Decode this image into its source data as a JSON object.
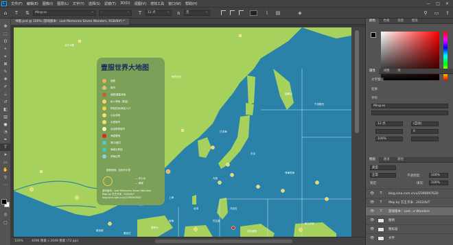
{
  "app": {
    "logo": "Ps"
  },
  "menu": [
    "文件(F)",
    "编辑(E)",
    "图像(I)",
    "图层(L)",
    "文字(Y)",
    "选择(S)",
    "滤镜(T)",
    "3D(D)",
    "视图(V)",
    "增效工具",
    "窗口(W)",
    "帮助(H)"
  ],
  "window_controls": [
    "—",
    "□",
    "✕"
  ],
  "options": {
    "font_family": "Ming-ss",
    "font_style": "-",
    "font_size": "12 点",
    "antialias": "无"
  },
  "doc_tab": "书图.psd @ 100% (游戏版本：Lost Memories Seven Wonders, RGB/8#) *",
  "legend": {
    "title": "壹服世界大地图",
    "items": [
      {
        "label": "首都",
        "color": "#e9b24a"
      },
      {
        "label": "城市",
        "color": "#d6c280"
      },
      {
        "label": "城堡/要塞领地",
        "color": "#c4622d"
      },
      {
        "label": "私人领地（数量）",
        "color": "#f6d36b"
      },
      {
        "label": "特色拍卖/商店入口",
        "color": "#f2d24a"
      },
      {
        "label": "公会领地",
        "color": "#f1e06a"
      },
      {
        "label": "大型城市",
        "color": "#f0e26f"
      },
      {
        "label": "自由贸易城市",
        "color": "#fff7b8"
      },
      {
        "label": "海盗基地",
        "color": "#d03024"
      },
      {
        "label": "港口/渡口",
        "color": "#54c7c2"
      },
      {
        "label": "海域分界线",
        "color": "#3ad2b8"
      },
      {
        "label": "领地边界",
        "color": "#8fd0e8"
      }
    ],
    "scale_label": "图例说明：比例尺示意",
    "compass_1": "— 中心点",
    "compass_2": "— 海域",
    "credits": [
      "游戏版本：Lost Memories Seven Wonders",
      "Map by 方王子米 · 2022/6/7",
      "blog.sina.com.cn/u/2390097620"
    ]
  },
  "map_labels": [
    "北方冰原",
    "勘察加",
    "西伯利亚",
    "千岛群岛",
    "日本海",
    "东京",
    "大阪",
    "北京",
    "上海",
    "台湾",
    "香港",
    "马尼拉",
    "菲律宾海",
    "南海",
    "巴拉望",
    "新加坡",
    "雅加达",
    "婆罗洲",
    "苏拉威西",
    "新几内亚"
  ],
  "status": {
    "zoom": "100%",
    "info": "4096 像素 x 2048 像素 (72 ppi)"
  },
  "panels": {
    "top_tabs": [
      "颜色",
      "色板",
      "渐变",
      "图案"
    ],
    "mid_tabs": [
      "属性",
      "调整",
      "库"
    ],
    "properties_title": "文字图层",
    "section_transform": "变换",
    "section_char": "字符",
    "char_font": "Ming-ss",
    "char_size": "12 点",
    "char_leading": "(自动)",
    "char_tracking": "0",
    "char_scale": "100%",
    "layers_tabs": [
      "图层",
      "通道",
      "路径"
    ],
    "layers_kind": "类型",
    "layers_mode": "正常",
    "layers_opacity_label": "不透明度:",
    "layers_opacity": "100%",
    "layers_lock_label": "锁定:",
    "layers_fill_label": "填充:",
    "layers_fill": "100%"
  },
  "layers": [
    {
      "name": "blog.sina.com.cn/u/2390097620",
      "type": "T",
      "selected": false
    },
    {
      "name": "Map by 方王子米 · 2022/6/7",
      "type": "T",
      "selected": false
    },
    {
      "name": "游戏版本：Lost...e Wonders",
      "type": "T",
      "selected": true
    },
    {
      "name": "图例",
      "type": "thumb",
      "selected": false
    },
    {
      "name": "图标层",
      "type": "thumb",
      "selected": false
    },
    {
      "name": "文字",
      "type": "thumb",
      "selected": false
    }
  ]
}
